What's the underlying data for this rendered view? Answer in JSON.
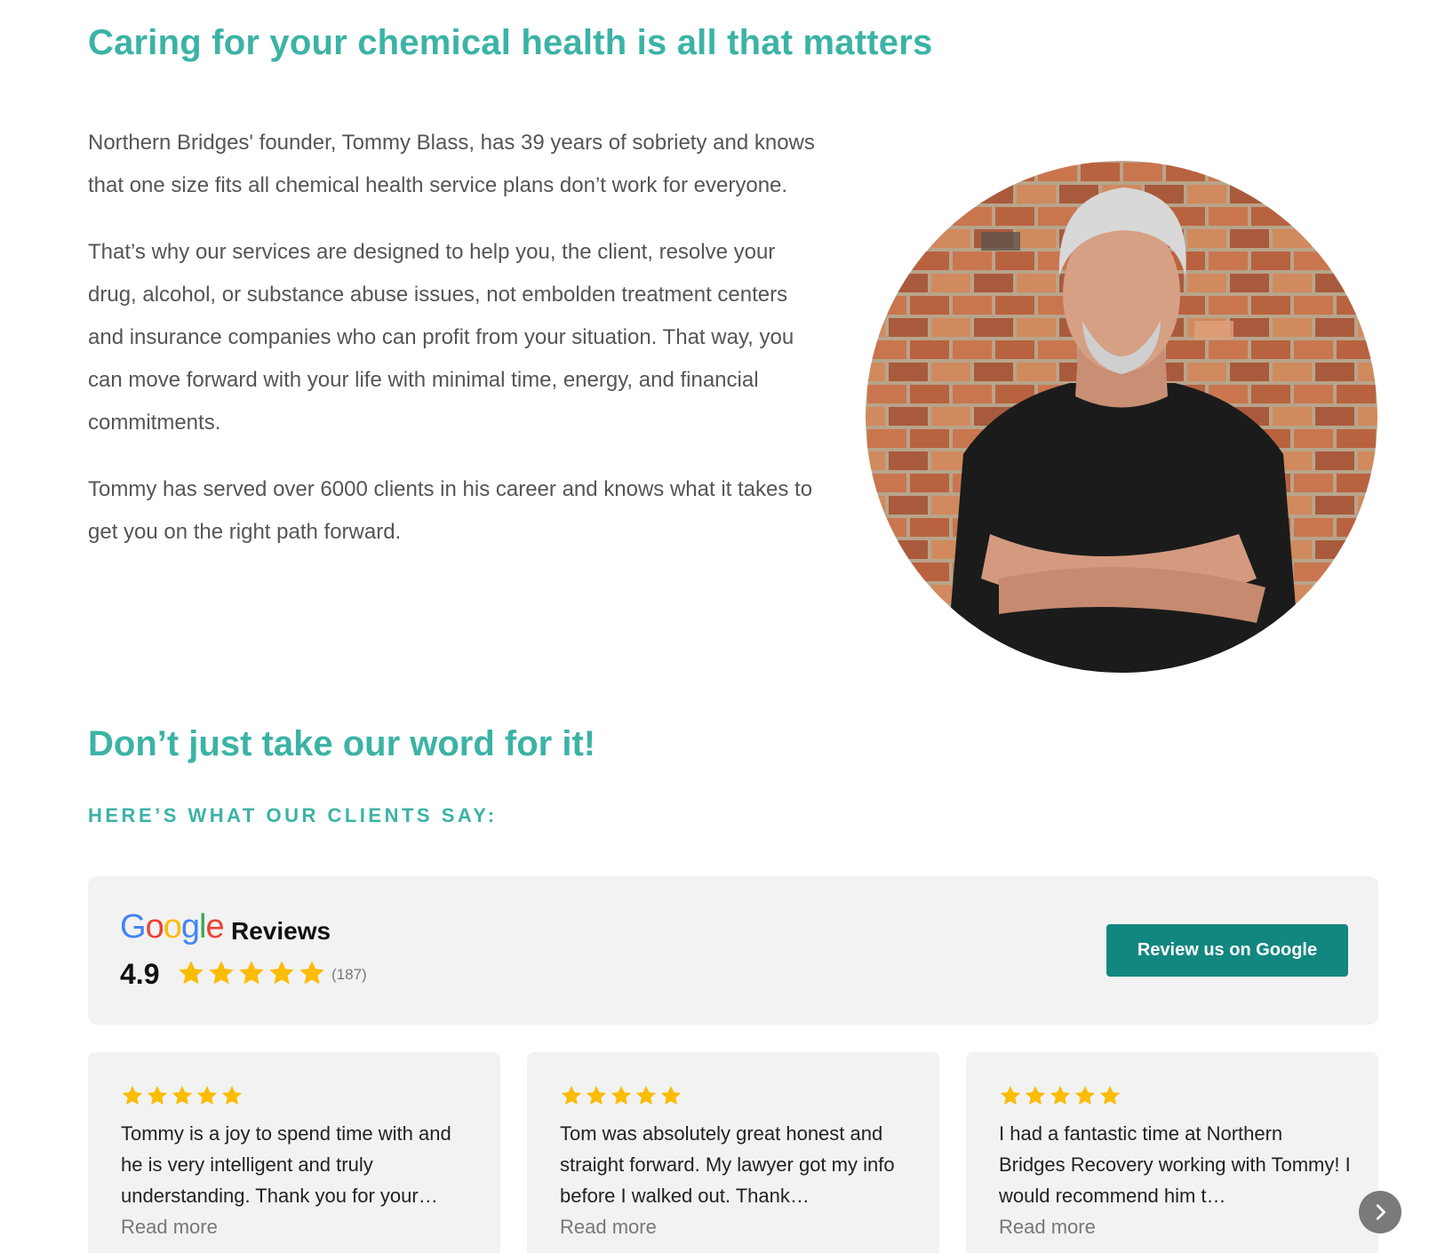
{
  "intro": {
    "heading": "Caring for your chemical health is all that matters",
    "paragraphs": [
      "Northern Bridges' founder, Tommy Blass, has 39 years of sobriety and knows that one size fits all chemical health service plans don’t work for everyone.",
      "That’s why our services are designed to help you, the client, resolve your drug, alcohol, or substance abuse issues, not embolden treatment centers and insurance companies who can profit from your situation.  That way, you can move forward with your life with minimal time, energy, and financial commitments.",
      "Tommy has served over 6000 clients in his career and knows what it takes to get you on the right path forward."
    ]
  },
  "testimonials": {
    "heading": "Don’t just take our word for it!",
    "kicker": "HERE’S WHAT OUR CLIENTS SAY:"
  },
  "google_summary": {
    "logo_letters": [
      "G",
      "o",
      "o",
      "g",
      "l",
      "e"
    ],
    "logo_colors": [
      "#4285F4",
      "#EA4335",
      "#FBBC05",
      "#4285F4",
      "#34A853",
      "#EA4335"
    ],
    "reviews_label": "Reviews",
    "rating": "4.9",
    "stars": 5,
    "count": "(187)",
    "button_label": "Review us on Google"
  },
  "reviews": [
    {
      "stars": 5,
      "text": "Tommy is a joy to spend time with and he is very intelligent and truly understanding. Thank you for your…",
      "more": "Read more"
    },
    {
      "stars": 5,
      "text": "Tom was absolutely great honest and straight forward. My lawyer got my info before I walked out. Thank…",
      "more": "Read more"
    },
    {
      "stars": 5,
      "text": "I had a fantastic time at Northern Bridges Recovery working with Tommy! I would recommend him t…",
      "more": "Read more"
    }
  ],
  "colors": {
    "accent": "#3bb3a5",
    "button": "#12877f",
    "star": "#fbbc04",
    "panel": "#f2f2f2"
  },
  "icons": {
    "star": "star-icon",
    "next": "chevron-right-icon"
  }
}
